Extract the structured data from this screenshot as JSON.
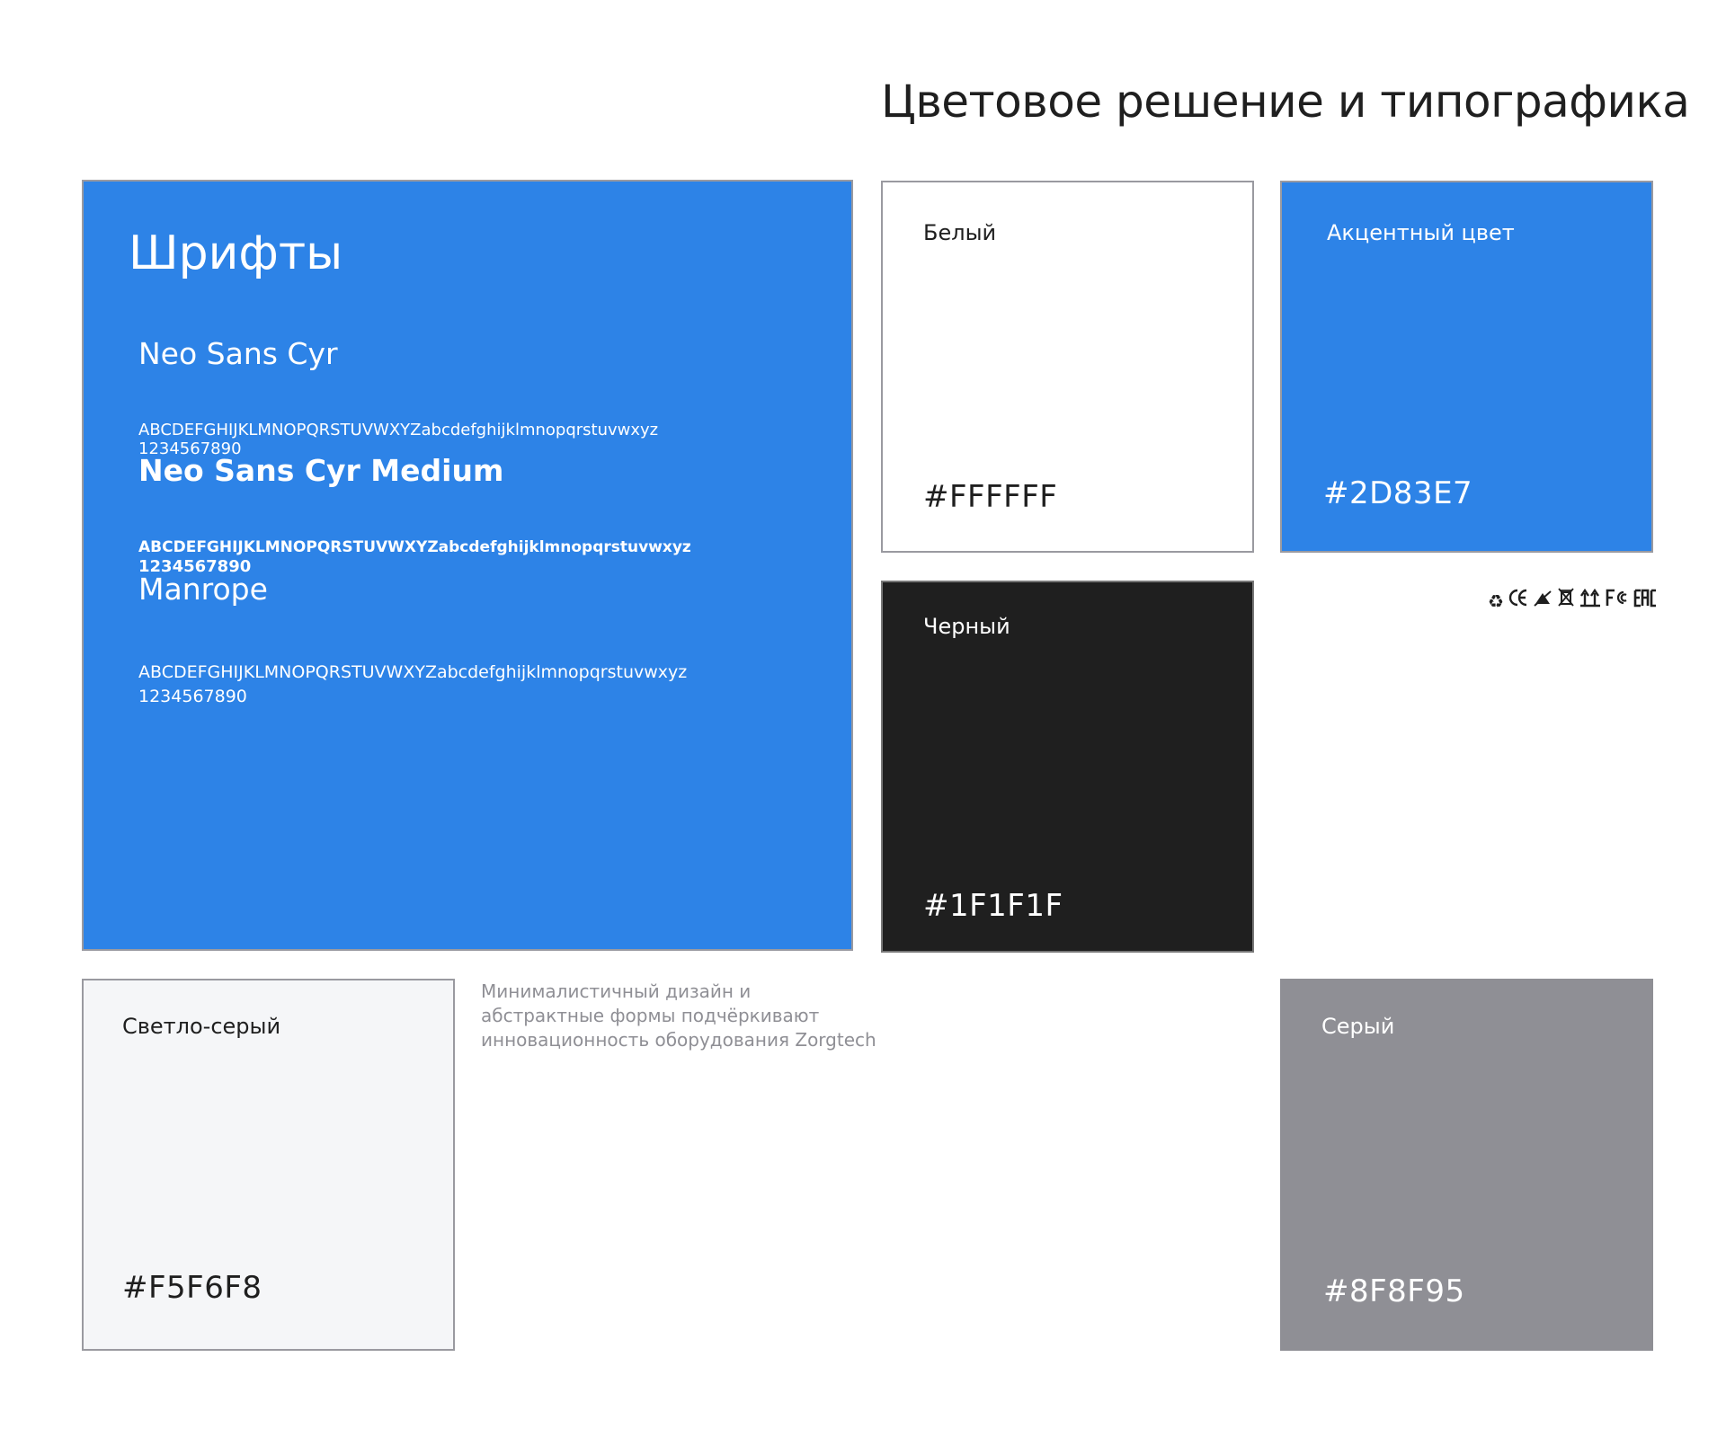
{
  "page": {
    "title": "Цветовое решение и типографика"
  },
  "fonts": {
    "title": "Шрифты",
    "items": [
      {
        "name": "Neo Sans Cyr",
        "alphabet": "ABCDEFGHIJKLMNOPQRSTUVWXYZabcdefghijklmnopqrstuvwxyz",
        "digits": "1234567890"
      },
      {
        "name": "Neo Sans Cyr Medium",
        "alphabet": "ABCDEFGHIJKLMNOPQRSTUVWXYZabcdefghijklmnopqrstuvwxyz",
        "digits": "1234567890"
      },
      {
        "name": "Manrope",
        "alphabet": "ABCDEFGHIJKLMNOPQRSTUVWXYZabcdefghijklmnopqrstuvwxyz",
        "digits": "1234567890"
      }
    ]
  },
  "swatches": {
    "white": {
      "label": "Белый",
      "hex": "#FFFFFF"
    },
    "accent": {
      "label": "Акцентный цвет",
      "hex": "#2D83E7"
    },
    "black": {
      "label": "Черный",
      "hex": "#1F1F1F"
    },
    "lightgray": {
      "label": "Светло-серый",
      "hex": "#F5F6F8"
    },
    "gray": {
      "label": "Серый",
      "hex": "#8F8F95"
    }
  },
  "description": "Минималистичный дизайн и абстрактные формы подчёркивают инновационность оборудования Zorgtech",
  "certifications": [
    "recycle-icon",
    "ce-mark-icon",
    "no-waste-bin-icon",
    "crossed-bin-icon",
    "this-way-up-icon",
    "fcc-mark-icon",
    "eac-mark-icon"
  ]
}
